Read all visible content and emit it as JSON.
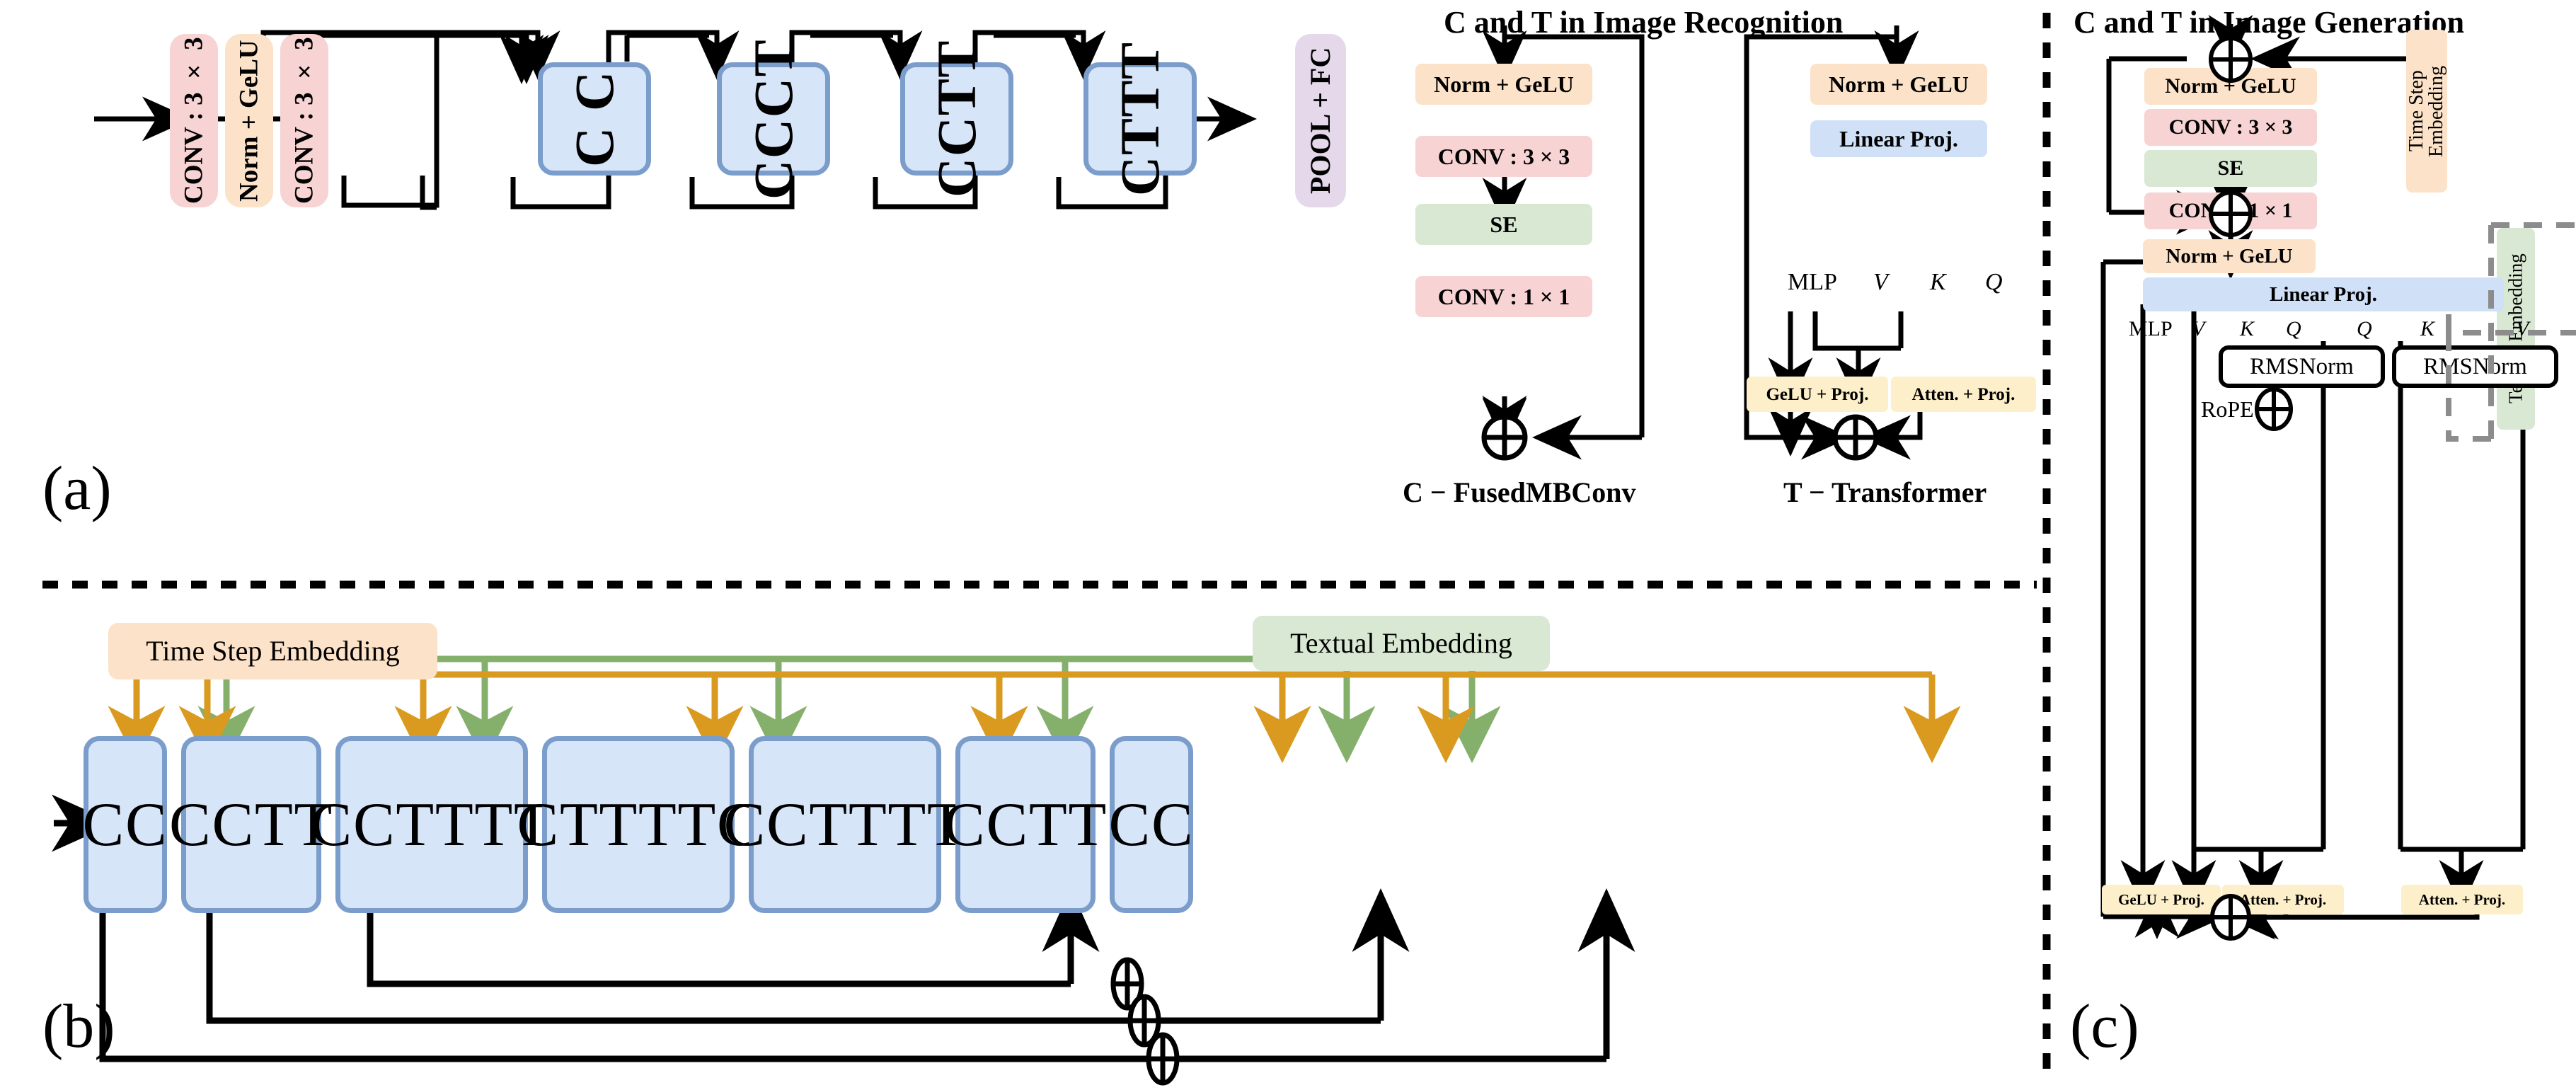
{
  "figure": {
    "panels": [
      "(a)",
      "(b)",
      "(c)"
    ],
    "panel_a_tag": "(a)",
    "panel_b_tag": "(b)",
    "panel_c_tag": "(c)"
  },
  "panel_a": {
    "stem": [
      {
        "label": "CONV : 3 × 3",
        "color": "#f7d3d4"
      },
      {
        "label": "Norm + GeLU",
        "color": "#fbe2c8"
      },
      {
        "label": "CONV : 3 × 3",
        "color": "#f7d3d4"
      }
    ],
    "stages": [
      "C C",
      "CCCT",
      "CCTT",
      "CTTT"
    ],
    "head": {
      "label": "POOL + FC",
      "color": "#e5d8ea"
    }
  },
  "recognition": {
    "title": "C and T in Image Recognition",
    "conv_branch": {
      "caption": "C − FusedMBConv",
      "blocks": [
        {
          "label": "Norm + GeLU",
          "color": "#fbe2c8"
        },
        {
          "label": "CONV : 3 × 3",
          "color": "#f7d3d4"
        },
        {
          "label": "SE",
          "color": "#d8e8d3"
        },
        {
          "label": "CONV : 1 × 1",
          "color": "#f7d3d4"
        }
      ],
      "sum_symbol": "⊕"
    },
    "transformer_branch": {
      "caption": "T − Transformer",
      "blocks": [
        {
          "label": "Norm + GeLU",
          "color": "#fbe2c8"
        },
        {
          "label": "Linear Proj.",
          "color": "#cfe0f7"
        }
      ],
      "tokens": [
        "MLP",
        "V",
        "K",
        "Q"
      ],
      "outputs": [
        {
          "label": "GeLU + Proj.",
          "color": "#fcefca"
        },
        {
          "label": "Atten. + Proj.",
          "color": "#fcefca"
        }
      ],
      "sum_symbol": "⊕"
    }
  },
  "panel_b": {
    "time_embedding": {
      "label": "Time Step Embedding",
      "color": "#fbe2c8",
      "arrow_color": "#d99a1f"
    },
    "text_embedding": {
      "label": "Textual Embedding",
      "color": "#d8e8d3",
      "arrow_color": "#85b06c"
    },
    "stages": [
      "CC",
      "CCTT",
      "CCTTTT",
      "CTTTTC",
      "CCTTTT",
      "CCTT",
      "CC"
    ],
    "skip_symbols": [
      "⊕",
      "⊕",
      "⊕"
    ]
  },
  "generation": {
    "title": "C and T in Image Generation",
    "time_embedding": {
      "label": "Time Step Embedding",
      "color": "#fbe2c8"
    },
    "text_embedding": {
      "label": "Textual Embedding",
      "color": "#d8e8d3"
    },
    "conv_part": {
      "blocks": [
        {
          "label": "Norm + GeLU",
          "color": "#fbe2c8"
        },
        {
          "label": "CONV : 3 × 3",
          "color": "#f7d3d4"
        },
        {
          "label": "SE",
          "color": "#d8e8d3"
        },
        {
          "label": "CONV : 1 × 1",
          "color": "#f7d3d4"
        }
      ],
      "sum_top": "⊕",
      "sum_bottom": "⊕"
    },
    "trans_part": {
      "blocks": [
        {
          "label": "Norm + GeLU",
          "color": "#fbe2c8"
        },
        {
          "label": "Linear Proj.",
          "color": "#cfe0f7"
        }
      ],
      "tokens": [
        "MLP",
        "V",
        "K",
        "Q",
        "Q",
        "K",
        "V"
      ],
      "rmsnorm_left": "RMSNorm",
      "rmsnorm_right": "RMSNorm",
      "rope_label": "RoPE",
      "rope_symbol": "⊕",
      "outputs": [
        {
          "label": "GeLU + Proj.",
          "color": "#fcefca"
        },
        {
          "label": "Atten. + Proj.",
          "color": "#fcefca"
        },
        {
          "label": "Atten. + Proj.",
          "color": "#fcefca"
        }
      ],
      "sum_symbol": "⊕"
    }
  },
  "colors": {
    "pink": "#f7d3d4",
    "peach": "#fbe2c8",
    "green": "#d8e8d3",
    "purple": "#e5d8ea",
    "block_fill": "#d7e5f8",
    "block_border": "#7b9dcb",
    "cream": "#fcefca",
    "light_blue": "#cfe0f7",
    "orange_arrow": "#d99a1f",
    "green_arrow": "#85b06c",
    "dashed_gray": "#8c8c8c"
  }
}
